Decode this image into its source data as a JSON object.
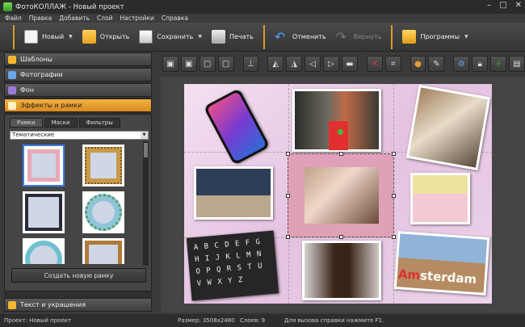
{
  "window": {
    "title": "ФотоКОЛЛАЖ - Новый проект"
  },
  "menu": [
    "Файл",
    "Правка",
    "Добавить",
    "Слой",
    "Настройки",
    "Справка"
  ],
  "toolbar": {
    "new_label": "Новый",
    "open_label": "Открыть",
    "save_label": "Сохранить",
    "print_label": "Печать",
    "undo_label": "Отменить",
    "redo_label": "Вернуть",
    "programs_label": "Программы"
  },
  "left_panel": {
    "sections": [
      "Шаблоны",
      "Фотографии",
      "Фон",
      "Эффекты и рамки",
      "Текст и украшения"
    ],
    "tabs": [
      "Рамки",
      "Маски",
      "Фильтры"
    ],
    "category_select": "Тематические",
    "create_frame_label": "Создать новую рамку"
  },
  "collage_text": {
    "sticker": "sterdam",
    "sticker_prefix": "Am"
  },
  "chalkboard": [
    "A B C D E F G",
    "H I J K L M N",
    "O P Q R S T U",
    "V W X Y Z"
  ],
  "status": {
    "project": "Проект:  Новый проект",
    "size": "Размер:  3508x2480",
    "layers": "Слоев:  9",
    "help": "Для вызова справки нажмите F1."
  },
  "colors": {
    "accent": "#e8a030",
    "panel": "#2f2f2f",
    "collage_bg": "#e9cbe5"
  }
}
